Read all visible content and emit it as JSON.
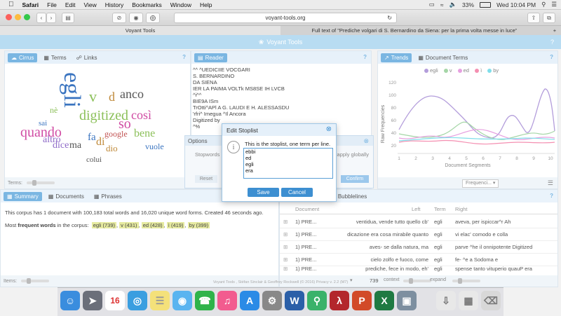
{
  "menubar": {
    "apple": "",
    "items": [
      "Safari",
      "File",
      "Edit",
      "View",
      "History",
      "Bookmarks",
      "Window",
      "Help"
    ],
    "battery": "33%",
    "clock": "Wed 10:04 PM"
  },
  "browser": {
    "url": "voyant-tools.org",
    "tabs": [
      "Voyant Tools",
      "Full text of \"Prediche volgari di S. Bernardino da Siena: per la prima volta messe in luce\""
    ]
  },
  "voyant": {
    "title": "Voyant Tools",
    "cirrus_tabs": [
      "Cirrus",
      "Terms",
      "Links"
    ],
    "reader_tab": "Reader",
    "trends_tabs": [
      "Trends",
      "Document Terms"
    ],
    "summary_tabs": [
      "Summary",
      "Documents",
      "Phrases"
    ],
    "bubble_tab": "Bubblelines",
    "terms_label": "Terms:",
    "items_label": "Items:",
    "help": "?",
    "summary_line1": "This corpus has 1 document with 100,183 total words and 16,020 unique word forms. Created 46 seconds ago.",
    "summary_prefix": "Most ",
    "summary_bold": "frequent words",
    "summary_suffix": " in the corpus:",
    "frequent": [
      "egli (739)",
      "v (431)",
      "ed (428)",
      "ì (419)",
      "by (399)"
    ],
    "reader_lines": [
      "^^ ^UEDICIIE VOCGARI",
      "S. BERNARDINO",
      "DA SIENA",
      "IER LA PAIMA VOLTk MS8SE IH LVCB",
      "^i^^",
      "BIE9A ISm",
      "TrOtti^APl A G. LAUDI E H. ALESSASDU",
      "'rfri^ Imegua ^Il Ancora",
      "Digitized by",
      "^%"
    ],
    "trends": {
      "legend": [
        "egli",
        "v",
        "ed",
        "ì",
        "by"
      ],
      "ylabel": "Raw Frequencies",
      "xlabel": "Document Segments",
      "yticks": [
        "20",
        "40",
        "60",
        "80",
        "100",
        "120"
      ],
      "xticks": [
        "1",
        "2",
        "3",
        "4",
        "5",
        "6",
        "7",
        "8",
        "9",
        "10"
      ],
      "frequencies_label": "Frequenci..."
    },
    "kwic": {
      "headers": [
        "Document",
        "Left",
        "Term",
        "Right"
      ],
      "rows": [
        {
          "doc": "1) PRE...",
          "left": "ventidua, vende tutto quello cb'",
          "term": "egli",
          "right": "aveva, per ispiccar^r Ah"
        },
        {
          "doc": "1) PRE...",
          "left": "dicazione era cosa mirabile quanto",
          "term": "egli",
          "right": "vi elac' comodo e colla"
        },
        {
          "doc": "1) PRE...",
          "left": "aves- se dalla natura, ma",
          "term": "egli",
          "right": "parve ^he il onnipotente Digitized"
        },
        {
          "doc": "1) PRE...",
          "left": "cielo zolfo e fuoco, come",
          "term": "egli",
          "right": "fe- ^e a Sodoma e"
        },
        {
          "doc": "1) PRE...",
          "left": "prediche, fece in modo, eh'",
          "term": "egli",
          "right": "spense tanto vituperio quauP era"
        }
      ],
      "context_label": "context",
      "context_value": "739",
      "expand_label": "expand"
    },
    "options_label": "Options",
    "stopwords_label": "Stopwords",
    "apply_globally": "apply globally",
    "reset_label": "Reset",
    "confirm_label": "Confirm",
    "footer": "Voyant Tools , Stéfan Sinclair & Geoffrey Rockwell (© 2016) Privacy v. 2.2 (M7)"
  },
  "dialog": {
    "title": "Edit Stoplist",
    "message": "This is the stoplist, one term per line.",
    "stoplist": [
      "ebbi",
      "ed",
      "egli",
      "era"
    ],
    "save": "Save",
    "cancel": "Cancel"
  },
  "cloud_words": [
    {
      "t": "egli",
      "c": "#3a74c0"
    },
    {
      "t": "digitized",
      "c": "#8cc05a"
    },
    {
      "t": "quando",
      "c": "#d04ba3"
    },
    {
      "t": "anco",
      "c": "#555"
    },
    {
      "t": "così",
      "c": "#d04ba3"
    },
    {
      "t": "so",
      "c": "#d04ba3"
    },
    {
      "t": "bene",
      "c": "#8cc05a"
    },
    {
      "t": "v",
      "c": "#8cc05a"
    },
    {
      "t": "d",
      "c": "#c08a3a"
    },
    {
      "t": "dice",
      "c": "#8e6ac8"
    },
    {
      "t": "altro",
      "c": "#8e6ac8"
    },
    {
      "t": "ma",
      "c": "#555"
    },
    {
      "t": "fa",
      "c": "#3a74c0"
    },
    {
      "t": "google",
      "c": "#c05050"
    },
    {
      "t": "colui",
      "c": "#555"
    },
    {
      "t": "di",
      "c": "#c08a3a"
    },
    {
      "t": "dio",
      "c": "#c08a3a"
    },
    {
      "t": "sai",
      "c": "#3a74c0"
    },
    {
      "t": "vuole",
      "c": "#3a74c0"
    },
    {
      "t": "nè",
      "c": "#8cc05a"
    }
  ]
}
